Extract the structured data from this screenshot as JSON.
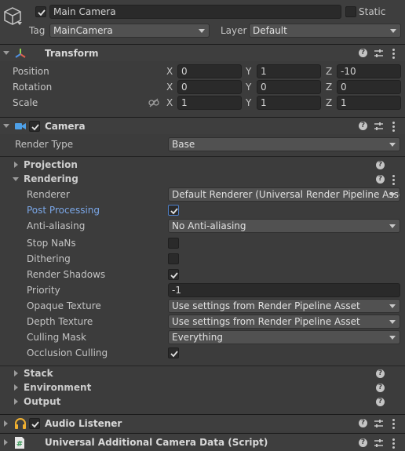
{
  "gameobject": {
    "name": "Main Camera",
    "active": true,
    "static_label": "Static",
    "static": false,
    "tag_label": "Tag",
    "tag_value": "MainCamera",
    "layer_label": "Layer",
    "layer_value": "Default"
  },
  "transform": {
    "title": "Transform",
    "position_label": "Position",
    "rotation_label": "Rotation",
    "scale_label": "Scale",
    "axis_x": "X",
    "axis_y": "Y",
    "axis_z": "Z",
    "position": {
      "x": "0",
      "y": "1",
      "z": "-10"
    },
    "rotation": {
      "x": "0",
      "y": "0",
      "z": "0"
    },
    "scale": {
      "x": "1",
      "y": "1",
      "z": "1"
    }
  },
  "camera": {
    "title": "Camera",
    "enabled": true,
    "render_type_label": "Render Type",
    "render_type_value": "Base",
    "projection_label": "Projection",
    "rendering_label": "Rendering",
    "renderer_label": "Renderer",
    "renderer_value": "Default Renderer (Universal Render Pipeline Asse",
    "post_processing_label": "Post Processing",
    "post_processing": true,
    "anti_aliasing_label": "Anti-aliasing",
    "anti_aliasing_value": "No Anti-aliasing",
    "stop_nans_label": "Stop NaNs",
    "stop_nans": false,
    "dithering_label": "Dithering",
    "dithering": false,
    "render_shadows_label": "Render Shadows",
    "render_shadows": true,
    "priority_label": "Priority",
    "priority_value": "-1",
    "opaque_texture_label": "Opaque Texture",
    "opaque_texture_value": "Use settings from Render Pipeline Asset",
    "depth_texture_label": "Depth Texture",
    "depth_texture_value": "Use settings from Render Pipeline Asset",
    "culling_mask_label": "Culling Mask",
    "culling_mask_value": "Everything",
    "occlusion_culling_label": "Occlusion Culling",
    "occlusion_culling": true,
    "stack_label": "Stack",
    "environment_label": "Environment",
    "output_label": "Output"
  },
  "audio_listener": {
    "title": "Audio Listener",
    "enabled": true
  },
  "additional_camera_data": {
    "title": "Universal Additional Camera Data (Script)"
  },
  "colors": {
    "background": "#3c3c3c",
    "field": "#2a2a2a",
    "dropdown": "#515151",
    "highlight_label": "#7aa6e6",
    "camera_icon": "#4ea0e8",
    "audio_icon": "#f0b030",
    "script_icon": "#3c9a5a"
  },
  "icons": [
    "gameobject-cube-icon",
    "transform-axes-icon",
    "camera-icon",
    "headphones-icon",
    "script-hash-icon",
    "help-icon",
    "presets-icon",
    "kebab-menu-icon",
    "link-scale-icon"
  ]
}
